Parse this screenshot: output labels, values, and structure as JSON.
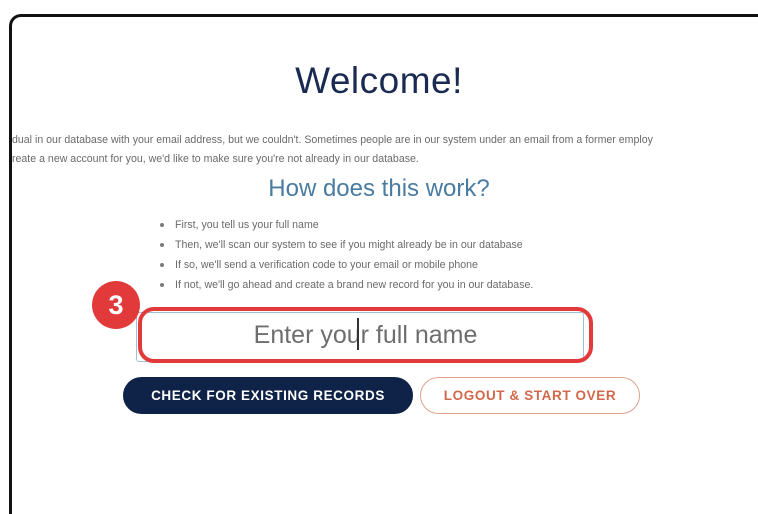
{
  "page": {
    "title": "Welcome!",
    "intro_line_1": "dual in our database with your email address, but we couldn't. Sometimes people are in our system under an email from a former employ",
    "intro_line_2": "reate a new account for you, we'd like to make sure you're not already in our database.",
    "subtitle": "How does this work?",
    "steps": [
      "First, you tell us your full name",
      "Then, we'll scan our system to see if you might already be in our database",
      "If so, we'll send a verification code to your email or mobile phone",
      "If not, we'll go ahead and create a brand new record for you in our database."
    ]
  },
  "form": {
    "name_placeholder": "Enter your full name",
    "check_button": "CHECK FOR EXISTING RECORDS",
    "logout_button": "LOGOUT & START OVER"
  },
  "annotation": {
    "step_number": "3",
    "highlight_color": "#e23a3a"
  },
  "colors": {
    "title": "#1a2a52",
    "subtitle": "#4a7ba0",
    "primary_button": "#0f2247",
    "secondary_button_text": "#d2684a"
  }
}
